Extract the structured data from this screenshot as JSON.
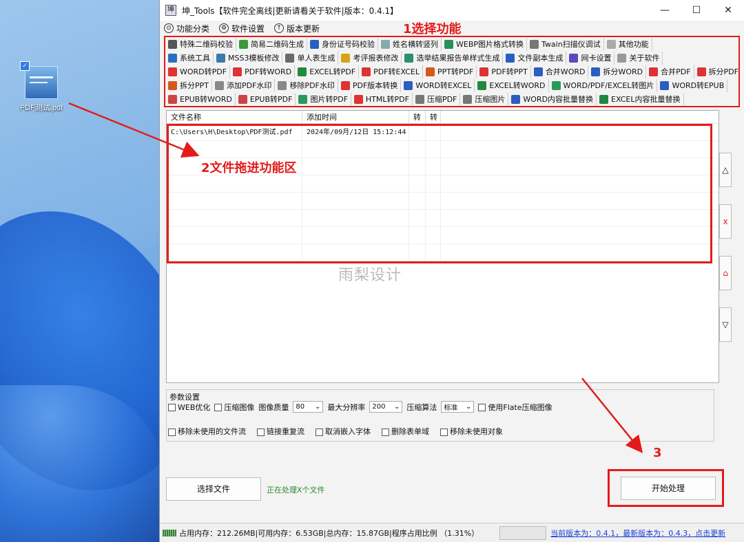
{
  "desktop": {
    "icon_label": "PDF测试.pdf"
  },
  "window": {
    "title": "坤_Tools【软件完全离线|更新请看关于软件|版本：0.4.1】",
    "minimize": "—",
    "maximize": "☐",
    "close": "✕"
  },
  "menu": [
    {
      "icon": "⊙",
      "label": "功能分类"
    },
    {
      "icon": "⚙",
      "label": "软件设置"
    },
    {
      "icon": "↑",
      "label": "版本更新"
    }
  ],
  "annotations": {
    "step1": "1选择功能",
    "step2": "2文件拖进功能区",
    "step3": "3"
  },
  "toolbar_rows": [
    [
      {
        "label": "特殊二维码校验",
        "color": "#555"
      },
      {
        "label": "简易二维码生成",
        "color": "#3a9a3a"
      },
      {
        "label": "身份证号码校验",
        "color": "#2b5fbf"
      },
      {
        "label": "姓名横转竖列",
        "color": "#8aa"
      },
      {
        "label": "WEBP图片格式转换",
        "color": "#2a8f5a"
      },
      {
        "label": "Twain扫描仪调试",
        "color": "#777"
      },
      {
        "label": "其他功能",
        "color": "#aaa"
      }
    ],
    [
      {
        "label": "系统工具",
        "color": "#2b6fbf"
      },
      {
        "label": "MSS3模板修改",
        "color": "#3a7ab0"
      },
      {
        "label": "单人表生成",
        "color": "#6a6a6a"
      },
      {
        "label": "考评报表修改",
        "color": "#d9a21b"
      },
      {
        "label": "选举结果报告单样式生成",
        "color": "#2e8f6a"
      },
      {
        "label": "文件副本生成",
        "color": "#2b5fbf"
      },
      {
        "label": "网卡设置",
        "color": "#5a4abf"
      },
      {
        "label": "关于软件",
        "color": "#999"
      }
    ],
    [
      {
        "label": "WORD转PDF",
        "color": "#d33"
      },
      {
        "label": "PDF转WORD",
        "color": "#d33"
      },
      {
        "label": "EXCEL转PDF",
        "color": "#1f8a3f"
      },
      {
        "label": "PDF转EXCEL",
        "color": "#d33"
      },
      {
        "label": "PPT转PDF",
        "color": "#d2591c"
      },
      {
        "label": "PDF转PPT",
        "color": "#d33"
      },
      {
        "label": "合并WORD",
        "color": "#2b5fbf"
      },
      {
        "label": "拆分WORD",
        "color": "#2b5fbf"
      },
      {
        "label": "合并PDF",
        "color": "#d33"
      },
      {
        "label": "拆分PDF",
        "color": "#d33"
      }
    ],
    [
      {
        "label": "拆分PPT",
        "color": "#d2591c"
      },
      {
        "label": "添加PDF水印",
        "color": "#888"
      },
      {
        "label": "移除PDF水印",
        "color": "#888"
      },
      {
        "label": "PDF版本转换",
        "color": "#d33"
      },
      {
        "label": "WORD转EXCEL",
        "color": "#2b5fbf"
      },
      {
        "label": "EXCEL转WORD",
        "color": "#1f8a3f"
      },
      {
        "label": "WORD/PDF/EXCEL转图片",
        "color": "#2a9a5a"
      },
      {
        "label": "WORD转EPUB",
        "color": "#2b5fbf"
      }
    ],
    [
      {
        "label": "EPUB转WORD",
        "color": "#c44"
      },
      {
        "label": "EPUB转PDF",
        "color": "#c44"
      },
      {
        "label": "图片转PDF",
        "color": "#2a9a5a"
      },
      {
        "label": "HTML转PDF",
        "color": "#d33"
      },
      {
        "label": "压缩PDF",
        "color": "#777"
      },
      {
        "label": "压缩图片",
        "color": "#777"
      },
      {
        "label": "WORD内容批量替换",
        "color": "#2b5fbf"
      },
      {
        "label": "EXCEL内容批量替换",
        "color": "#1f8a3f"
      }
    ]
  ],
  "file_list": {
    "columns": [
      "文件名称",
      "添加时间",
      "转",
      "转"
    ],
    "rows": [
      {
        "name": "C:\\Users\\H\\Desktop\\PDF测试.pdf",
        "time": "2024年/09月/12日 15:12:44"
      }
    ]
  },
  "watermark": "雨梨设计",
  "side_buttons": [
    "△",
    "x",
    "⌂",
    "▽"
  ],
  "params": {
    "title": "参数设置",
    "row1": {
      "web_opt": "WEB优化",
      "compress_img": "压缩图像",
      "img_quality_label": "图像质量",
      "img_quality": "80",
      "max_res_label": "最大分辨率",
      "max_res": "200",
      "algo_label": "压缩算法",
      "algo": "标准",
      "flate": "使用Flate压缩图像"
    },
    "row2": {
      "remove_streams": "移除未使用的文件流",
      "link_reflow": "链接重复流",
      "unembed_fonts": "取消嵌入字体",
      "delete_forms": "删除表单域",
      "remove_objects": "移除未使用对象"
    }
  },
  "actions": {
    "choose_file": "选择文件",
    "processing": "正在处理X个文件",
    "start": "开始处理"
  },
  "status": {
    "memory": "占用内存：212.26MB|可用内存：6.53GB|总内存：15.87GB|程序占用比例 （1.31%）",
    "version_link": "当前版本为：0.4.1，最新版本为：0.4.3，点击更新"
  },
  "colors": {
    "annotation_red": "#e31b1b",
    "processing_green": "#2a8a2a",
    "link_blue": "#1a3fd6"
  }
}
